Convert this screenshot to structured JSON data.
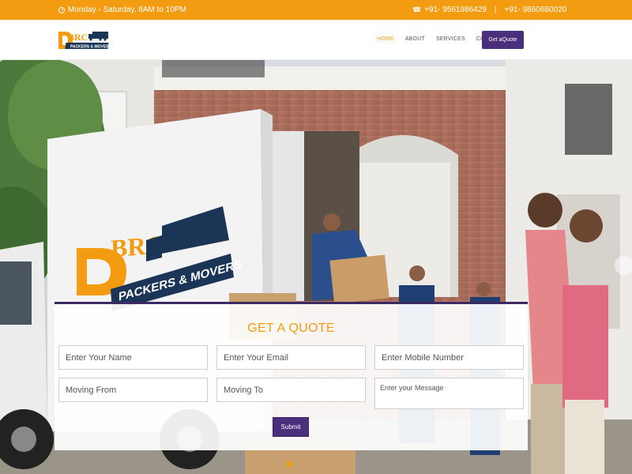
{
  "topbar": {
    "hours": "Monday - Saturday, 8AM to 10PM",
    "phone1": "+91- 9561986429",
    "separator": "|",
    "phone2": "+91- 9860680020"
  },
  "header": {
    "logo_text_top": "DBRC",
    "logo_text_bottom": "PACKERS & MOVERS",
    "nav": [
      {
        "label": "HOME",
        "active": true
      },
      {
        "label": "ABOUT",
        "active": false
      },
      {
        "label": "SERVICES",
        "active": false
      },
      {
        "label": "CONTACT",
        "active": false
      }
    ],
    "cta_label": "Get aQuote"
  },
  "hero": {
    "truck_logo_top": "BRC",
    "truck_logo_bottom": "PACKERS & MOVERS"
  },
  "quote_form": {
    "title": "GET A QUOTE",
    "name_placeholder": "Enter Your Name",
    "email_placeholder": "Enter Your Email",
    "mobile_placeholder": "Enter Mobile Number",
    "from_placeholder": "Moving From",
    "to_placeholder": "Moving To",
    "message_placeholder": "Enter your Message",
    "submit_label": "Submit"
  },
  "colors": {
    "accent_orange": "#f39c12",
    "brand_purple": "#4a2f7c"
  }
}
